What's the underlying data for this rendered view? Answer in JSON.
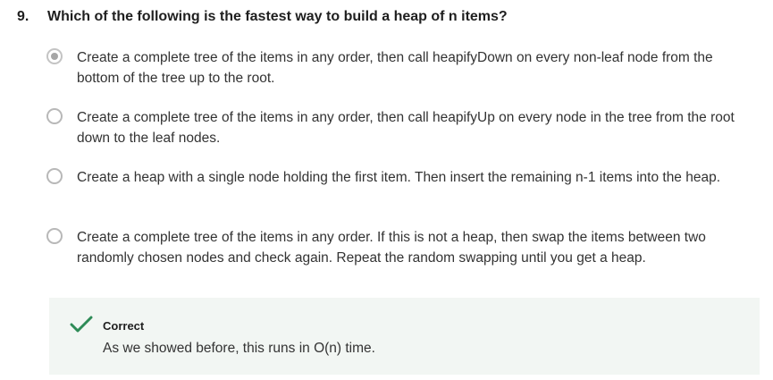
{
  "question": {
    "number": "9.",
    "text": "Which of the following is the fastest way to build a heap of n items?"
  },
  "options": [
    {
      "text": "Create a complete tree of the items in any order, then call heapifyDown on every non-leaf node from the bottom of the tree up to the root.",
      "selected": true
    },
    {
      "text": "Create a complete tree of the items in any order, then call heapifyUp on every node in the tree from the root down to the leaf nodes.",
      "selected": false
    },
    {
      "text": "Create a heap with a single node holding the first item. Then insert the remaining n-1 items into the heap.",
      "selected": false
    },
    {
      "text": "Create a complete tree of the items in any order. If this is not a heap, then swap the items between two randomly chosen nodes and check again. Repeat the random swapping until you get a heap.",
      "selected": false
    }
  ],
  "feedback": {
    "title": "Correct",
    "text": "As we showed before, this runs in O(n) time.",
    "icon": "checkmark-icon",
    "color": "#2e8b57"
  },
  "colors": {
    "feedback_bg": "#f2f6f3",
    "radio_border": "#b8b8b8",
    "radio_selected_dot": "#a6a6a6"
  }
}
